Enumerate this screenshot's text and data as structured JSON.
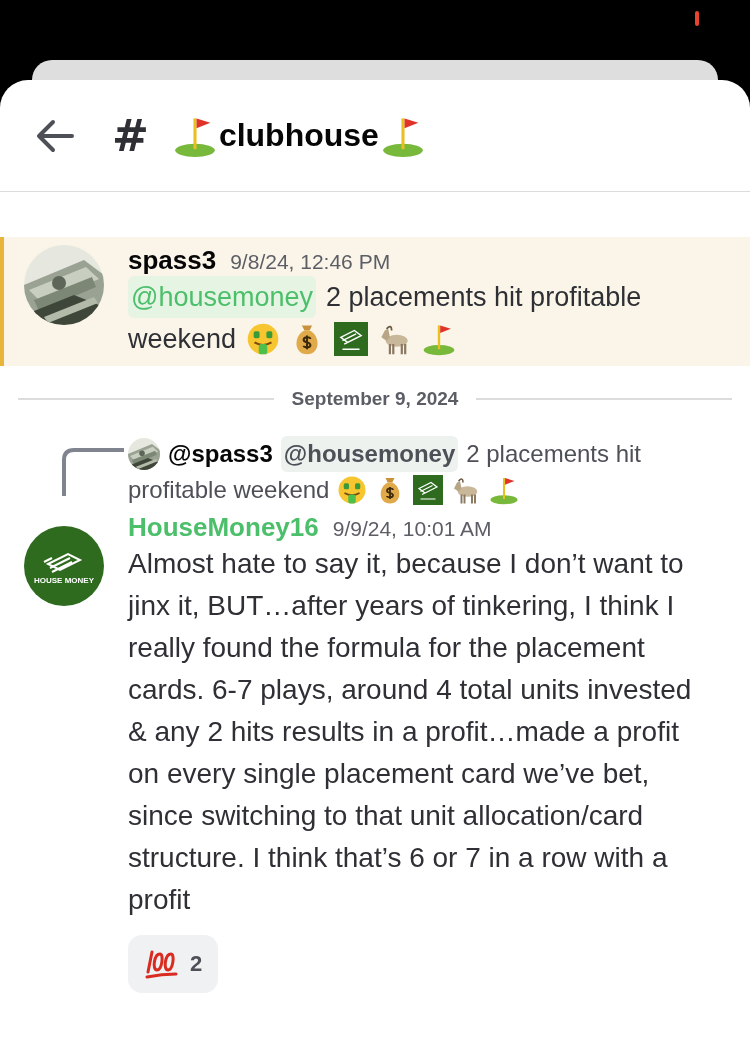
{
  "header": {
    "channel_prefix": "#",
    "channel_name": "clubhouse"
  },
  "messages": [
    {
      "author": "spass3",
      "timestamp": "9/8/24, 12:46 PM",
      "highlighted": true,
      "mention": "@housemoney",
      "text": "2 placements hit profitable",
      "text_line2": "weekend",
      "emojis": [
        {
          "kind": "money_face"
        },
        {
          "kind": "money_bag"
        },
        {
          "kind": "logo"
        },
        {
          "kind": "goat"
        },
        {
          "kind": "flag"
        }
      ]
    }
  ],
  "date_divider": "September 9, 2024",
  "reply": {
    "author": "@spass3",
    "mention": "@housemoney",
    "text": "2 placements hit",
    "text_line2": "profitable weekend",
    "emojis": [
      {
        "kind": "money_face"
      },
      {
        "kind": "money_bag"
      },
      {
        "kind": "logo"
      },
      {
        "kind": "goat"
      },
      {
        "kind": "flag"
      }
    ]
  },
  "message2": {
    "author": "HouseMoney16",
    "avatar_label": "HOUSE MONEY",
    "timestamp": "9/9/24, 10:01 AM",
    "highlighted": false,
    "text": "Almost hate to say it, because I don’t want to jinx it, BUT…after years of tinkering, I think I really found the formula for the placement cards. 6-7 plays, around 4 total units invested & any 2 hits results in a profit…made a profit on every single placement card we’ve bet, since switching to that unit allocation/card structure. I think that’s 6 or 7 in a row with a profit",
    "reactions": [
      {
        "count": "2",
        "selected": false
      }
    ]
  }
}
